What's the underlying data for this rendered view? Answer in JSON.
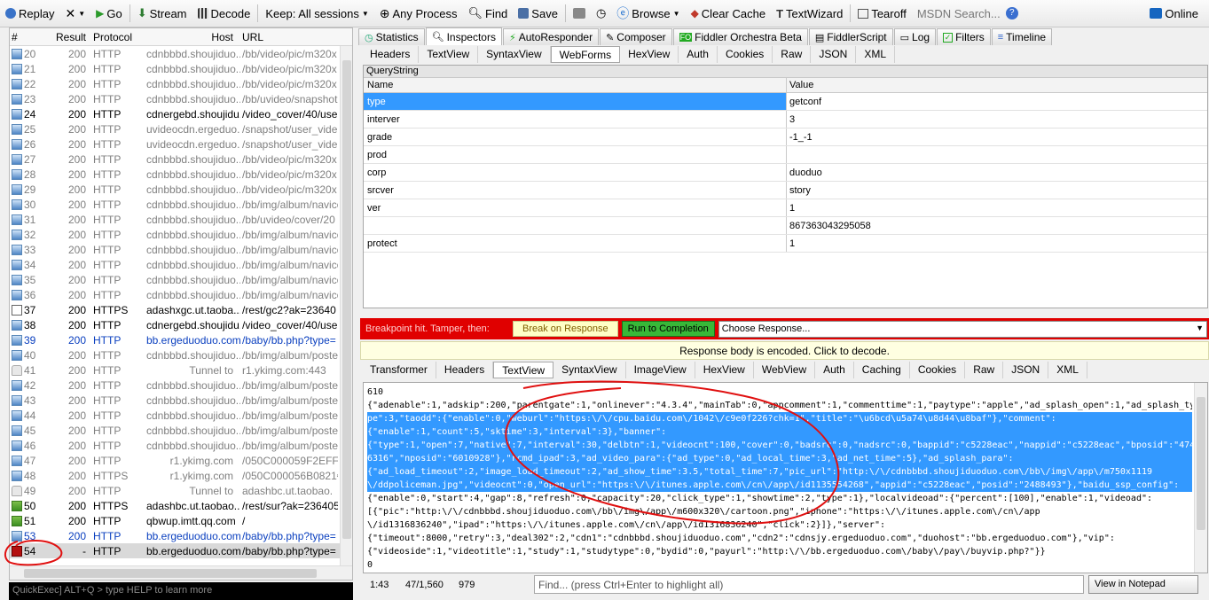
{
  "toolbar": {
    "replay": "Replay",
    "remove": "✕",
    "go": "Go",
    "stream": "Stream",
    "decode": "Decode",
    "keep": "Keep: All sessions",
    "any_process": "Any Process",
    "find": "Find",
    "save": "Save",
    "browse": "Browse",
    "clear_cache": "Clear Cache",
    "textwizard": "TextWizard",
    "tearoff": "Tearoff",
    "msdn_search": "MSDN Search...",
    "online": "Online",
    "colors": {
      "go": "#2a9a2a",
      "stream": "#2e7d32",
      "clear_cache": "#c0392b",
      "online": "#1565c0"
    }
  },
  "sessions": {
    "headers": {
      "num": "#",
      "result": "Result",
      "protocol": "Protocol",
      "host": "Host",
      "url": "URL"
    },
    "rows": [
      {
        "num": "20",
        "result": "200",
        "protocol": "HTTP",
        "host": "cdnbbbd.shoujiduo...",
        "url": "/bb/video/pic/m320x",
        "style": "gray",
        "icon": "get"
      },
      {
        "num": "21",
        "result": "200",
        "protocol": "HTTP",
        "host": "cdnbbbd.shoujiduo...",
        "url": "/bb/video/pic/m320x",
        "style": "gray",
        "icon": "get"
      },
      {
        "num": "22",
        "result": "200",
        "protocol": "HTTP",
        "host": "cdnbbbd.shoujiduo...",
        "url": "/bb/video/pic/m320x",
        "style": "gray",
        "icon": "get"
      },
      {
        "num": "23",
        "result": "200",
        "protocol": "HTTP",
        "host": "cdnbbbd.shoujiduo...",
        "url": "/bb/uvideo/snapshot",
        "style": "gray",
        "icon": "get"
      },
      {
        "num": "24",
        "result": "200",
        "protocol": "HTTP",
        "host": "cdnergebd.shoujidu...",
        "url": "/video_cover/40/use",
        "style": "black",
        "icon": "get"
      },
      {
        "num": "25",
        "result": "200",
        "protocol": "HTTP",
        "host": "uvideocdn.ergeduo...",
        "url": "/snapshot/user_vide",
        "style": "gray",
        "icon": "get"
      },
      {
        "num": "26",
        "result": "200",
        "protocol": "HTTP",
        "host": "uvideocdn.ergeduo...",
        "url": "/snapshot/user_vide",
        "style": "gray",
        "icon": "get"
      },
      {
        "num": "27",
        "result": "200",
        "protocol": "HTTP",
        "host": "cdnbbbd.shoujiduo...",
        "url": "/bb/video/pic/m320x",
        "style": "gray",
        "icon": "get"
      },
      {
        "num": "28",
        "result": "200",
        "protocol": "HTTP",
        "host": "cdnbbbd.shoujiduo...",
        "url": "/bb/video/pic/m320x",
        "style": "gray",
        "icon": "get"
      },
      {
        "num": "29",
        "result": "200",
        "protocol": "HTTP",
        "host": "cdnbbbd.shoujiduo...",
        "url": "/bb/video/pic/m320x",
        "style": "gray",
        "icon": "get"
      },
      {
        "num": "30",
        "result": "200",
        "protocol": "HTTP",
        "host": "cdnbbbd.shoujiduo...",
        "url": "/bb/img/album/navico",
        "style": "gray",
        "icon": "get"
      },
      {
        "num": "31",
        "result": "200",
        "protocol": "HTTP",
        "host": "cdnbbbd.shoujiduo...",
        "url": "/bb/uvideo/cover/20",
        "style": "gray",
        "icon": "get"
      },
      {
        "num": "32",
        "result": "200",
        "protocol": "HTTP",
        "host": "cdnbbbd.shoujiduo...",
        "url": "/bb/img/album/navico",
        "style": "gray",
        "icon": "get"
      },
      {
        "num": "33",
        "result": "200",
        "protocol": "HTTP",
        "host": "cdnbbbd.shoujiduo...",
        "url": "/bb/img/album/navico",
        "style": "gray",
        "icon": "get"
      },
      {
        "num": "34",
        "result": "200",
        "protocol": "HTTP",
        "host": "cdnbbbd.shoujiduo...",
        "url": "/bb/img/album/navico",
        "style": "gray",
        "icon": "get"
      },
      {
        "num": "35",
        "result": "200",
        "protocol": "HTTP",
        "host": "cdnbbbd.shoujiduo...",
        "url": "/bb/img/album/navico",
        "style": "gray",
        "icon": "get"
      },
      {
        "num": "36",
        "result": "200",
        "protocol": "HTTP",
        "host": "cdnbbbd.shoujiduo...",
        "url": "/bb/img/album/navico",
        "style": "gray",
        "icon": "get"
      },
      {
        "num": "37",
        "result": "200",
        "protocol": "HTTPS",
        "host": "adashxgc.ut.taoba...",
        "url": "/rest/gc2?ak=23640",
        "style": "black",
        "icon": "js"
      },
      {
        "num": "38",
        "result": "200",
        "protocol": "HTTP",
        "host": "cdnergebd.shoujidu...",
        "url": "/video_cover/40/use",
        "style": "black",
        "icon": "get"
      },
      {
        "num": "39",
        "result": "200",
        "protocol": "HTTP",
        "host": "bb.ergeduoduo.com",
        "url": "/baby/bb.php?type=",
        "style": "blue",
        "icon": "get"
      },
      {
        "num": "40",
        "result": "200",
        "protocol": "HTTP",
        "host": "cdnbbbd.shoujiduo...",
        "url": "/bb/img/album/poste",
        "style": "gray",
        "icon": "get"
      },
      {
        "num": "41",
        "result": "200",
        "protocol": "HTTP",
        "host": "Tunnel to",
        "url": "r1.ykimg.com:443",
        "style": "gray",
        "icon": "lock"
      },
      {
        "num": "42",
        "result": "200",
        "protocol": "HTTP",
        "host": "cdnbbbd.shoujiduo...",
        "url": "/bb/img/album/poste",
        "style": "gray",
        "icon": "get"
      },
      {
        "num": "43",
        "result": "200",
        "protocol": "HTTP",
        "host": "cdnbbbd.shoujiduo...",
        "url": "/bb/img/album/poste",
        "style": "gray",
        "icon": "get"
      },
      {
        "num": "44",
        "result": "200",
        "protocol": "HTTP",
        "host": "cdnbbbd.shoujiduo...",
        "url": "/bb/img/album/poste",
        "style": "gray",
        "icon": "get"
      },
      {
        "num": "45",
        "result": "200",
        "protocol": "HTTP",
        "host": "cdnbbbd.shoujiduo...",
        "url": "/bb/img/album/poste",
        "style": "gray",
        "icon": "get"
      },
      {
        "num": "46",
        "result": "200",
        "protocol": "HTTP",
        "host": "cdnbbbd.shoujiduo...",
        "url": "/bb/img/album/poste",
        "style": "gray",
        "icon": "get"
      },
      {
        "num": "47",
        "result": "200",
        "protocol": "HTTP",
        "host": "r1.ykimg.com",
        "url": "/050C000059F2EFF3",
        "style": "gray",
        "icon": "get"
      },
      {
        "num": "48",
        "result": "200",
        "protocol": "HTTPS",
        "host": "r1.ykimg.com",
        "url": "/050C000056B0821€",
        "style": "gray",
        "icon": "get"
      },
      {
        "num": "49",
        "result": "200",
        "protocol": "HTTP",
        "host": "Tunnel to",
        "url": "adashbc.ut.taobao.",
        "style": "gray",
        "icon": "lock"
      },
      {
        "num": "50",
        "result": "200",
        "protocol": "HTTPS",
        "host": "adashbc.ut.taobao....",
        "url": "/rest/sur?ak=236405",
        "style": "black",
        "icon": "warn"
      },
      {
        "num": "51",
        "result": "200",
        "protocol": "HTTP",
        "host": "qbwup.imtt.qq.com",
        "url": "/",
        "style": "black",
        "icon": "warn"
      },
      {
        "num": "53",
        "result": "200",
        "protocol": "HTTP",
        "host": "bb.ergeduoduo.com",
        "url": "/baby/bb.php?type=",
        "style": "blue",
        "icon": "get"
      },
      {
        "num": "54",
        "result": "-",
        "protocol": "HTTP",
        "host": "bb.ergeduoduo.com",
        "url": "/baby/bb.php?type=",
        "style": "black",
        "icon": "bp",
        "selected": true
      }
    ]
  },
  "quickexec": "QuickExec] ALT+Q > type HELP to learn more",
  "inspector_tabs": [
    "Statistics",
    "Inspectors",
    "AutoResponder",
    "Composer",
    "Fiddler Orchestra Beta",
    "FiddlerScript",
    "Log",
    "Filters",
    "Timeline"
  ],
  "request_tabs": [
    "Headers",
    "TextView",
    "SyntaxView",
    "WebForms",
    "HexView",
    "Auth",
    "Cookies",
    "Raw",
    "JSON",
    "XML"
  ],
  "querystring": {
    "title": "QueryString",
    "col_name": "Name",
    "col_value": "Value",
    "rows": [
      {
        "name": "type",
        "value": "getconf"
      },
      {
        "name": "interver",
        "value": "3"
      },
      {
        "name": "grade",
        "value": "-1_-1"
      },
      {
        "name": "prod",
        "value": ""
      },
      {
        "name": "corp",
        "value": "duoduo"
      },
      {
        "name": "srcver",
        "value": "story"
      },
      {
        "name": "ver",
        "value": "1"
      },
      {
        "name": "",
        "value": "867363043295058"
      },
      {
        "name": "protect",
        "value": "1"
      }
    ]
  },
  "breakpoint": {
    "text": "Breakpoint hit. Tamper, then:",
    "break_on_response": "Break on Response",
    "run_to_completion": "Run to Completion",
    "choose_response": "Choose Response..."
  },
  "encoded_notice": "Response body is encoded. Click to decode.",
  "response_tabs": [
    "Transformer",
    "Headers",
    "TextView",
    "SyntaxView",
    "ImageView",
    "HexView",
    "WebView",
    "Auth",
    "Caching",
    "Cookies",
    "Raw",
    "JSON",
    "XML"
  ],
  "response_body": [
    "610",
    "{\"adenable\":1,\"adskip\":200,\"parentgate\":1,\"onlinever\":\"4.3.4\",\"mainTab\":0,\"appcomment\":1,\"commenttime\":1,\"paytype\":\"apple\",\"ad_splash_open\":1,\"ad_splash_ty",
    "pe\":3,\"taodd\":{\"enable\":0,\"weburl\":\"https:\\/\\/cpu.baidu.com\\/1042\\/c9e0f226?chk=1\",\"title\":\"\\u6bcd\\u5a74\\u8d44\\u8baf\"},\"comment\":",
    "{\"enable\":1,\"count\":5,\"sktime\":3,\"interval\":3},\"banner\":",
    "{\"type\":1,\"open\":7,\"native\":7,\"interval\":30,\"delbtn\":1,\"videocnt\":100,\"cover\":0,\"badsrc\":0,\"nadsrc\":0,\"bappid\":\"c5228eac\",\"nappid\":\"c5228eac\",\"bposid\":\"474",
    "6316\",\"nposid\":\"6010928\"},\"rcmd_ipad\":3,\"ad_video_para\":{\"ad_type\":0,\"ad_local_time\":3,\"ad_net_time\":5},\"ad_splash_para\":",
    "{\"ad_load_timeout\":2,\"image_load_timeout\":2,\"ad_show_time\":3.5,\"total_time\":7,\"pic_url\":\"http:\\/\\/cdnbbbd.shoujiduoduo.com\\/bb\\/img\\/app\\/m750x1119",
    "\\/ddpoliceman.jpg\",\"videocnt\":0,\"open_url\":\"https:\\/\\/itunes.apple.com\\/cn\\/app\\/id1135554268\",\"appid\":\"c5228eac\",\"posid\":\"2488493\"},\"baidu_ssp_config\":",
    "{\"enable\":0,\"start\":4,\"gap\":8,\"refresh\":0,\"capacity\":20,\"click_type\":1,\"showtime\":2,\"type\":1},\"localvideoad\":{\"percent\":[100],\"enable\":1,\"videoad\":",
    "[{\"pic\":\"http:\\/\\/cdnbbbd.shoujiduoduo.com\\/bb\\/img\\/app\\/m600x320\\/cartoon.png\",\"iphone\":\"https:\\/\\/itunes.apple.com\\/cn\\/app",
    "\\/id1316836240\",\"ipad\":\"https:\\/\\/itunes.apple.com\\/cn\\/app\\/id1316836240\",\"click\":2}]},\"server\":",
    "{\"timeout\":8000,\"retry\":3,\"deal302\":2,\"cdn1\":\"cdnbbbd.shoujiduoduo.com\",\"cdn2\":\"cdnsjy.ergeduoduo.com\",\"duohost\":\"bb.ergeduoduo.com\"},\"vip\":",
    "{\"videoside\":1,\"videotitle\":1,\"study\":1,\"studytype\":0,\"bydid\":0,\"payurl\":\"http:\\/\\/bb.ergeduoduo.com\\/baby\\/pay\\/buyvip.php?\"}}",
    "0"
  ],
  "status": {
    "position": "1:43",
    "size": "47/1,560",
    "count": "979",
    "find_placeholder": "Find... (press Ctrl+Enter to highlight all)",
    "view_notepad": "View in Notepad"
  }
}
